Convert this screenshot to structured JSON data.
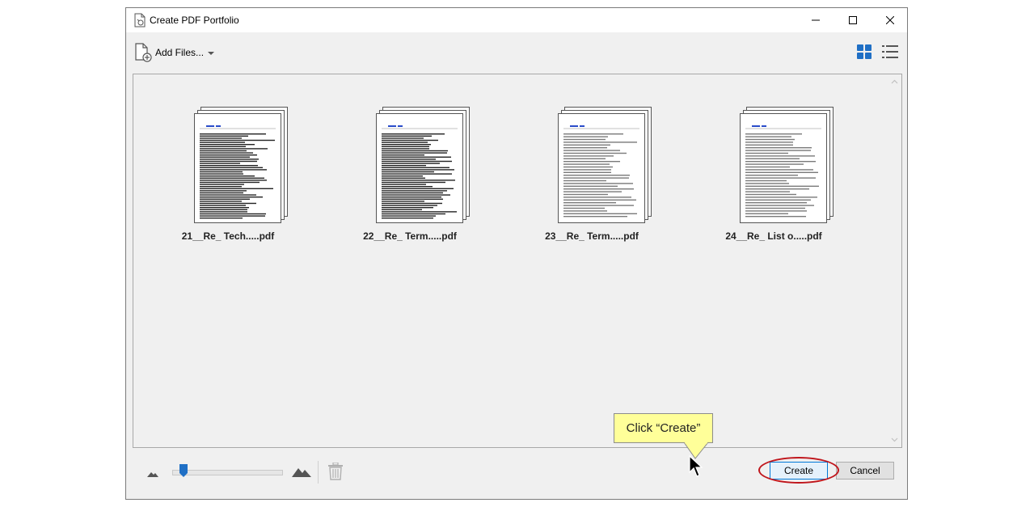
{
  "window": {
    "title": "Create PDF Portfolio"
  },
  "toolbar": {
    "add_files_label": "Add Files..."
  },
  "files": [
    {
      "name": "21__Re_ Tech.....pdf"
    },
    {
      "name": "22__Re_ Term.....pdf"
    },
    {
      "name": "23__Re_ Term.....pdf"
    },
    {
      "name": "24__Re_ List o.....pdf"
    }
  ],
  "footer": {
    "create_label": "Create",
    "cancel_label": "Cancel",
    "zoom_level": 0.1
  },
  "annotation": {
    "callout_text": "Click “Create”"
  },
  "colors": {
    "accent": "#0078d7",
    "callout_bg": "#ffff99",
    "highlight": "#c0161c"
  }
}
